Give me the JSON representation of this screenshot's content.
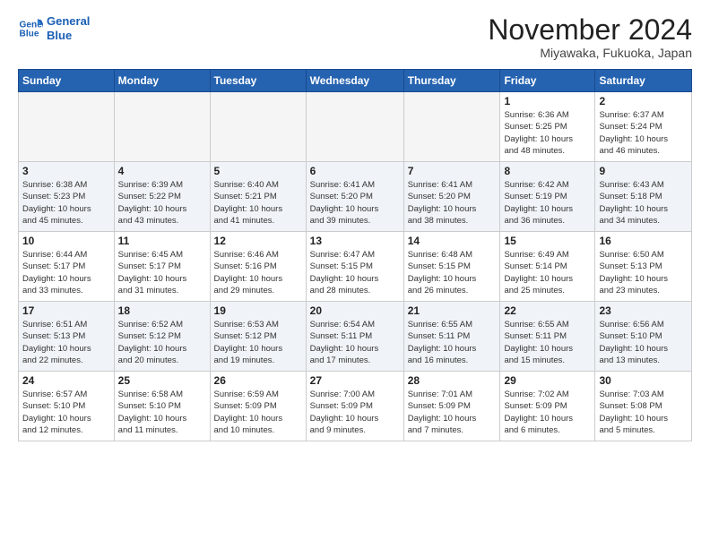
{
  "logo": {
    "line1": "General",
    "line2": "Blue"
  },
  "title": "November 2024",
  "location": "Miyawaka, Fukuoka, Japan",
  "headers": [
    "Sunday",
    "Monday",
    "Tuesday",
    "Wednesday",
    "Thursday",
    "Friday",
    "Saturday"
  ],
  "weeks": [
    [
      {
        "day": "",
        "info": ""
      },
      {
        "day": "",
        "info": ""
      },
      {
        "day": "",
        "info": ""
      },
      {
        "day": "",
        "info": ""
      },
      {
        "day": "",
        "info": ""
      },
      {
        "day": "1",
        "info": "Sunrise: 6:36 AM\nSunset: 5:25 PM\nDaylight: 10 hours\nand 48 minutes."
      },
      {
        "day": "2",
        "info": "Sunrise: 6:37 AM\nSunset: 5:24 PM\nDaylight: 10 hours\nand 46 minutes."
      }
    ],
    [
      {
        "day": "3",
        "info": "Sunrise: 6:38 AM\nSunset: 5:23 PM\nDaylight: 10 hours\nand 45 minutes."
      },
      {
        "day": "4",
        "info": "Sunrise: 6:39 AM\nSunset: 5:22 PM\nDaylight: 10 hours\nand 43 minutes."
      },
      {
        "day": "5",
        "info": "Sunrise: 6:40 AM\nSunset: 5:21 PM\nDaylight: 10 hours\nand 41 minutes."
      },
      {
        "day": "6",
        "info": "Sunrise: 6:41 AM\nSunset: 5:20 PM\nDaylight: 10 hours\nand 39 minutes."
      },
      {
        "day": "7",
        "info": "Sunrise: 6:41 AM\nSunset: 5:20 PM\nDaylight: 10 hours\nand 38 minutes."
      },
      {
        "day": "8",
        "info": "Sunrise: 6:42 AM\nSunset: 5:19 PM\nDaylight: 10 hours\nand 36 minutes."
      },
      {
        "day": "9",
        "info": "Sunrise: 6:43 AM\nSunset: 5:18 PM\nDaylight: 10 hours\nand 34 minutes."
      }
    ],
    [
      {
        "day": "10",
        "info": "Sunrise: 6:44 AM\nSunset: 5:17 PM\nDaylight: 10 hours\nand 33 minutes."
      },
      {
        "day": "11",
        "info": "Sunrise: 6:45 AM\nSunset: 5:17 PM\nDaylight: 10 hours\nand 31 minutes."
      },
      {
        "day": "12",
        "info": "Sunrise: 6:46 AM\nSunset: 5:16 PM\nDaylight: 10 hours\nand 29 minutes."
      },
      {
        "day": "13",
        "info": "Sunrise: 6:47 AM\nSunset: 5:15 PM\nDaylight: 10 hours\nand 28 minutes."
      },
      {
        "day": "14",
        "info": "Sunrise: 6:48 AM\nSunset: 5:15 PM\nDaylight: 10 hours\nand 26 minutes."
      },
      {
        "day": "15",
        "info": "Sunrise: 6:49 AM\nSunset: 5:14 PM\nDaylight: 10 hours\nand 25 minutes."
      },
      {
        "day": "16",
        "info": "Sunrise: 6:50 AM\nSunset: 5:13 PM\nDaylight: 10 hours\nand 23 minutes."
      }
    ],
    [
      {
        "day": "17",
        "info": "Sunrise: 6:51 AM\nSunset: 5:13 PM\nDaylight: 10 hours\nand 22 minutes."
      },
      {
        "day": "18",
        "info": "Sunrise: 6:52 AM\nSunset: 5:12 PM\nDaylight: 10 hours\nand 20 minutes."
      },
      {
        "day": "19",
        "info": "Sunrise: 6:53 AM\nSunset: 5:12 PM\nDaylight: 10 hours\nand 19 minutes."
      },
      {
        "day": "20",
        "info": "Sunrise: 6:54 AM\nSunset: 5:11 PM\nDaylight: 10 hours\nand 17 minutes."
      },
      {
        "day": "21",
        "info": "Sunrise: 6:55 AM\nSunset: 5:11 PM\nDaylight: 10 hours\nand 16 minutes."
      },
      {
        "day": "22",
        "info": "Sunrise: 6:55 AM\nSunset: 5:11 PM\nDaylight: 10 hours\nand 15 minutes."
      },
      {
        "day": "23",
        "info": "Sunrise: 6:56 AM\nSunset: 5:10 PM\nDaylight: 10 hours\nand 13 minutes."
      }
    ],
    [
      {
        "day": "24",
        "info": "Sunrise: 6:57 AM\nSunset: 5:10 PM\nDaylight: 10 hours\nand 12 minutes."
      },
      {
        "day": "25",
        "info": "Sunrise: 6:58 AM\nSunset: 5:10 PM\nDaylight: 10 hours\nand 11 minutes."
      },
      {
        "day": "26",
        "info": "Sunrise: 6:59 AM\nSunset: 5:09 PM\nDaylight: 10 hours\nand 10 minutes."
      },
      {
        "day": "27",
        "info": "Sunrise: 7:00 AM\nSunset: 5:09 PM\nDaylight: 10 hours\nand 9 minutes."
      },
      {
        "day": "28",
        "info": "Sunrise: 7:01 AM\nSunset: 5:09 PM\nDaylight: 10 hours\nand 7 minutes."
      },
      {
        "day": "29",
        "info": "Sunrise: 7:02 AM\nSunset: 5:09 PM\nDaylight: 10 hours\nand 6 minutes."
      },
      {
        "day": "30",
        "info": "Sunrise: 7:03 AM\nSunset: 5:08 PM\nDaylight: 10 hours\nand 5 minutes."
      }
    ]
  ]
}
